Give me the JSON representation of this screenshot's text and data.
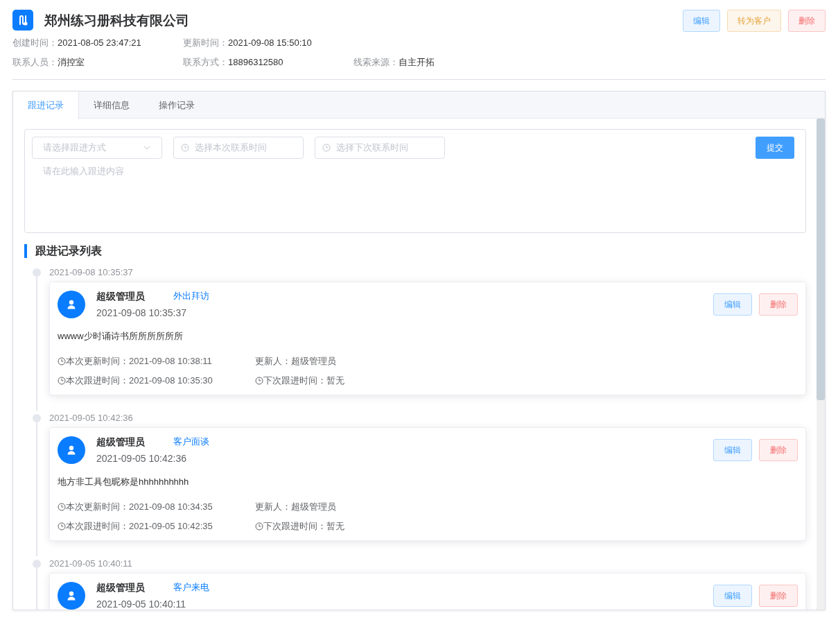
{
  "header": {
    "title": "郑州练习册科技有限公司",
    "actions": [
      {
        "label": "编辑",
        "kind": "primary"
      },
      {
        "label": "转为客户",
        "kind": "warning"
      },
      {
        "label": "删除",
        "kind": "danger"
      }
    ],
    "field_rows": [
      [
        {
          "label": "创建时间：",
          "value": "2021-08-05 23:47:21"
        },
        {
          "label": "更新时间：",
          "value": "2021-09-08 15:50:10"
        }
      ],
      [
        {
          "label": "联系人员：",
          "value": "消控室"
        },
        {
          "label": "联系方式：",
          "value": "18896312580"
        },
        {
          "label": "线索来源：",
          "value": "自主开拓"
        }
      ]
    ]
  },
  "tabs": [
    {
      "label": "跟进记录",
      "selected": true
    },
    {
      "label": "详细信息",
      "selected": false
    },
    {
      "label": "操作记录",
      "selected": false
    }
  ],
  "form": {
    "method_select": {
      "placeholder": "请选择跟进方式"
    },
    "this_time": {
      "placeholder": "选择本次联系时间"
    },
    "next_time": {
      "placeholder": "选择下次联系时间"
    },
    "content": {
      "placeholder": "请在此输入跟进内容"
    },
    "submit": "提交"
  },
  "list_title": "跟进记录列表",
  "records": [
    {
      "timestamp": "2021-09-08 10:35:37",
      "user": "超级管理员",
      "method": "外出拜访",
      "created": "2021-09-08 10:35:37",
      "content": "wwww少时诵诗书所所所所所所",
      "meta": [
        {
          "kind": "clock",
          "text": "本次更新时间：2021-09-08 10:38:11"
        },
        {
          "kind": "plain",
          "text": "更新人：超级管理员"
        },
        {
          "kind": "clock",
          "text": "本次跟进时间：2021-09-08 10:35:30"
        },
        {
          "kind": "clock",
          "text": "下次跟进时间：暂无"
        }
      ],
      "actions": [
        {
          "label": "编辑",
          "kind": "primary"
        },
        {
          "label": "删除",
          "kind": "danger"
        }
      ]
    },
    {
      "timestamp": "2021-09-05 10:42:36",
      "user": "超级管理员",
      "method": "客户面谈",
      "created": "2021-09-05 10:42:36",
      "content": "地方非工具包昵称是hhhhhhhhhh",
      "meta": [
        {
          "kind": "clock",
          "text": "本次更新时间：2021-09-08 10:34:35"
        },
        {
          "kind": "plain",
          "text": "更新人：超级管理员"
        },
        {
          "kind": "clock",
          "text": "本次跟进时间：2021-09-05 10:42:35"
        },
        {
          "kind": "clock",
          "text": "下次跟进时间：暂无"
        }
      ],
      "actions": [
        {
          "label": "编辑",
          "kind": "primary"
        },
        {
          "label": "删除",
          "kind": "danger"
        }
      ]
    },
    {
      "timestamp": "2021-09-05 10:40:11",
      "user": "超级管理员",
      "method": "客户来电",
      "created": "2021-09-05 10:40:11",
      "actions": [
        {
          "label": "编辑",
          "kind": "primary"
        },
        {
          "label": "删除",
          "kind": "danger"
        }
      ]
    }
  ]
}
